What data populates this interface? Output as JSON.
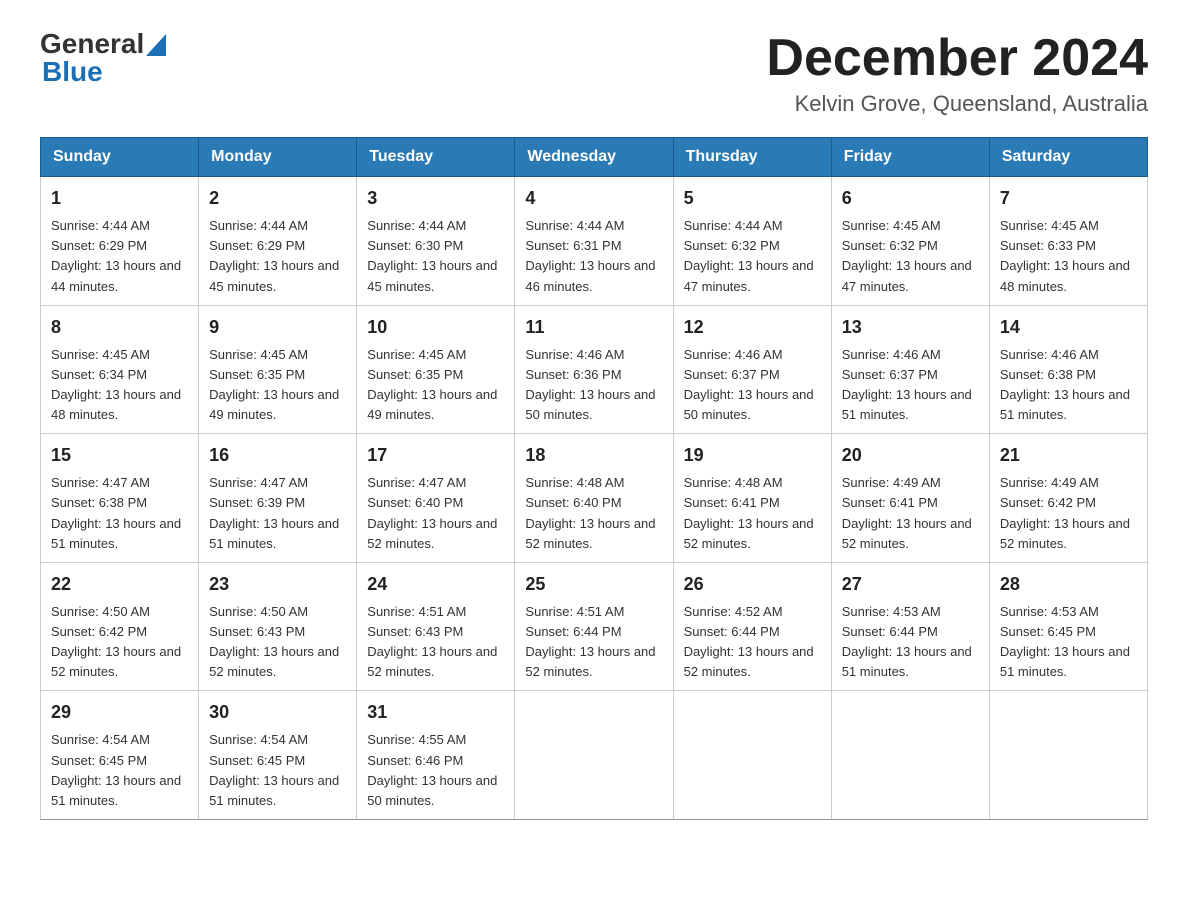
{
  "header": {
    "logo_general": "General",
    "logo_blue": "Blue",
    "month_title": "December 2024",
    "location": "Kelvin Grove, Queensland, Australia"
  },
  "days_of_week": [
    "Sunday",
    "Monday",
    "Tuesday",
    "Wednesday",
    "Thursday",
    "Friday",
    "Saturday"
  ],
  "weeks": [
    [
      {
        "day": "1",
        "sunrise": "4:44 AM",
        "sunset": "6:29 PM",
        "daylight": "13 hours and 44 minutes."
      },
      {
        "day": "2",
        "sunrise": "4:44 AM",
        "sunset": "6:29 PM",
        "daylight": "13 hours and 45 minutes."
      },
      {
        "day": "3",
        "sunrise": "4:44 AM",
        "sunset": "6:30 PM",
        "daylight": "13 hours and 45 minutes."
      },
      {
        "day": "4",
        "sunrise": "4:44 AM",
        "sunset": "6:31 PM",
        "daylight": "13 hours and 46 minutes."
      },
      {
        "day": "5",
        "sunrise": "4:44 AM",
        "sunset": "6:32 PM",
        "daylight": "13 hours and 47 minutes."
      },
      {
        "day": "6",
        "sunrise": "4:45 AM",
        "sunset": "6:32 PM",
        "daylight": "13 hours and 47 minutes."
      },
      {
        "day": "7",
        "sunrise": "4:45 AM",
        "sunset": "6:33 PM",
        "daylight": "13 hours and 48 minutes."
      }
    ],
    [
      {
        "day": "8",
        "sunrise": "4:45 AM",
        "sunset": "6:34 PM",
        "daylight": "13 hours and 48 minutes."
      },
      {
        "day": "9",
        "sunrise": "4:45 AM",
        "sunset": "6:35 PM",
        "daylight": "13 hours and 49 minutes."
      },
      {
        "day": "10",
        "sunrise": "4:45 AM",
        "sunset": "6:35 PM",
        "daylight": "13 hours and 49 minutes."
      },
      {
        "day": "11",
        "sunrise": "4:46 AM",
        "sunset": "6:36 PM",
        "daylight": "13 hours and 50 minutes."
      },
      {
        "day": "12",
        "sunrise": "4:46 AM",
        "sunset": "6:37 PM",
        "daylight": "13 hours and 50 minutes."
      },
      {
        "day": "13",
        "sunrise": "4:46 AM",
        "sunset": "6:37 PM",
        "daylight": "13 hours and 51 minutes."
      },
      {
        "day": "14",
        "sunrise": "4:46 AM",
        "sunset": "6:38 PM",
        "daylight": "13 hours and 51 minutes."
      }
    ],
    [
      {
        "day": "15",
        "sunrise": "4:47 AM",
        "sunset": "6:38 PM",
        "daylight": "13 hours and 51 minutes."
      },
      {
        "day": "16",
        "sunrise": "4:47 AM",
        "sunset": "6:39 PM",
        "daylight": "13 hours and 51 minutes."
      },
      {
        "day": "17",
        "sunrise": "4:47 AM",
        "sunset": "6:40 PM",
        "daylight": "13 hours and 52 minutes."
      },
      {
        "day": "18",
        "sunrise": "4:48 AM",
        "sunset": "6:40 PM",
        "daylight": "13 hours and 52 minutes."
      },
      {
        "day": "19",
        "sunrise": "4:48 AM",
        "sunset": "6:41 PM",
        "daylight": "13 hours and 52 minutes."
      },
      {
        "day": "20",
        "sunrise": "4:49 AM",
        "sunset": "6:41 PM",
        "daylight": "13 hours and 52 minutes."
      },
      {
        "day": "21",
        "sunrise": "4:49 AM",
        "sunset": "6:42 PM",
        "daylight": "13 hours and 52 minutes."
      }
    ],
    [
      {
        "day": "22",
        "sunrise": "4:50 AM",
        "sunset": "6:42 PM",
        "daylight": "13 hours and 52 minutes."
      },
      {
        "day": "23",
        "sunrise": "4:50 AM",
        "sunset": "6:43 PM",
        "daylight": "13 hours and 52 minutes."
      },
      {
        "day": "24",
        "sunrise": "4:51 AM",
        "sunset": "6:43 PM",
        "daylight": "13 hours and 52 minutes."
      },
      {
        "day": "25",
        "sunrise": "4:51 AM",
        "sunset": "6:44 PM",
        "daylight": "13 hours and 52 minutes."
      },
      {
        "day": "26",
        "sunrise": "4:52 AM",
        "sunset": "6:44 PM",
        "daylight": "13 hours and 52 minutes."
      },
      {
        "day": "27",
        "sunrise": "4:53 AM",
        "sunset": "6:44 PM",
        "daylight": "13 hours and 51 minutes."
      },
      {
        "day": "28",
        "sunrise": "4:53 AM",
        "sunset": "6:45 PM",
        "daylight": "13 hours and 51 minutes."
      }
    ],
    [
      {
        "day": "29",
        "sunrise": "4:54 AM",
        "sunset": "6:45 PM",
        "daylight": "13 hours and 51 minutes."
      },
      {
        "day": "30",
        "sunrise": "4:54 AM",
        "sunset": "6:45 PM",
        "daylight": "13 hours and 51 minutes."
      },
      {
        "day": "31",
        "sunrise": "4:55 AM",
        "sunset": "6:46 PM",
        "daylight": "13 hours and 50 minutes."
      },
      null,
      null,
      null,
      null
    ]
  ]
}
